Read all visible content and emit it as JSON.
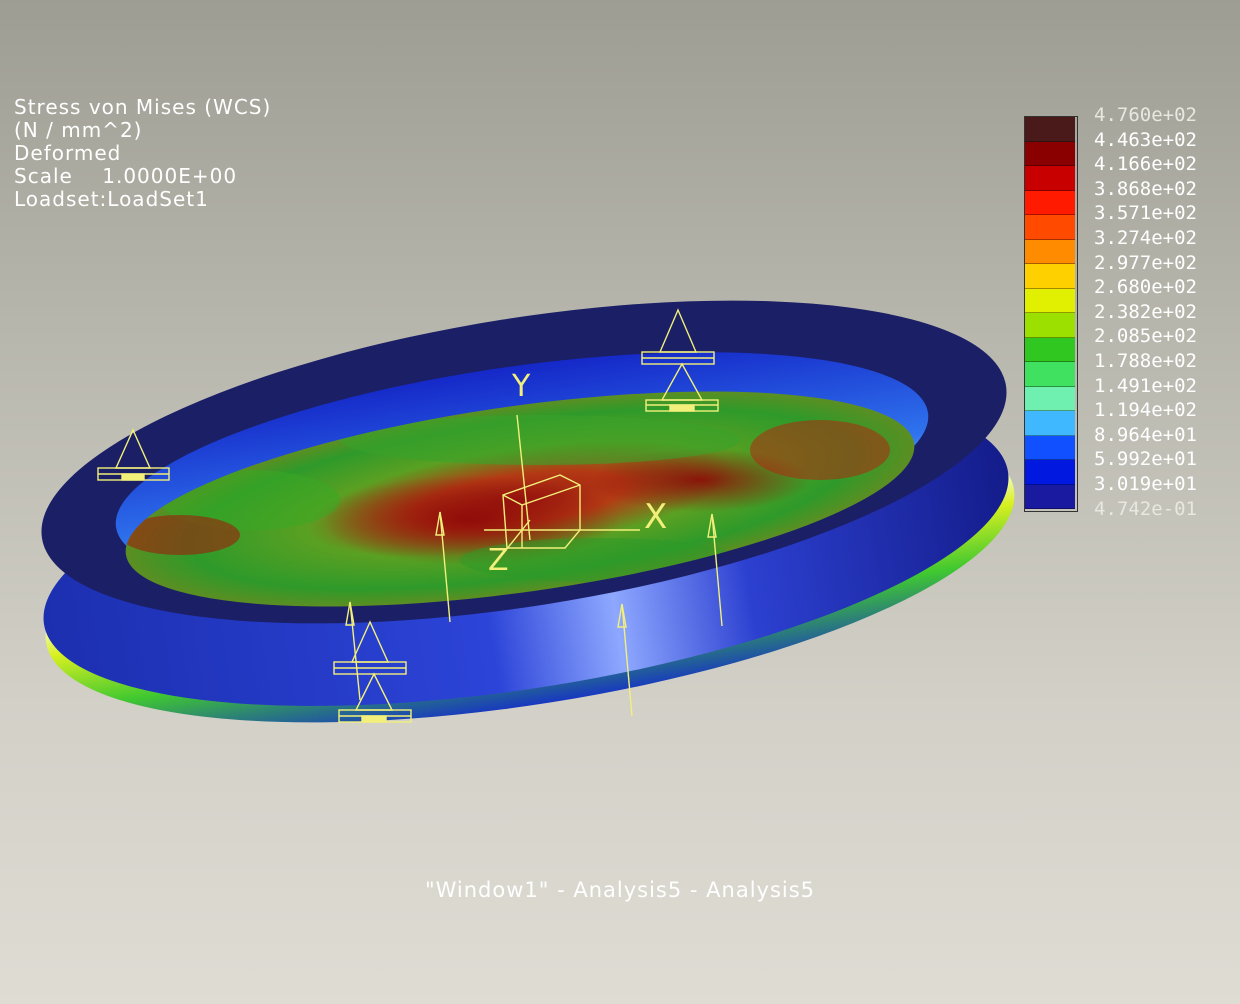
{
  "result_info": {
    "quantity": "Stress von Mises (WCS)",
    "units": "(N / mm^2)",
    "mode": "Deformed",
    "scale_label": "Scale",
    "scale_value": "1.0000E+00",
    "loadset": "Loadset:LoadSet1"
  },
  "legend": {
    "labels": [
      "4.760e+02",
      "4.463e+02",
      "4.166e+02",
      "3.868e+02",
      "3.571e+02",
      "3.274e+02",
      "2.977e+02",
      "2.680e+02",
      "2.382e+02",
      "2.085e+02",
      "1.788e+02",
      "1.491e+02",
      "1.194e+02",
      "8.964e+01",
      "5.992e+01",
      "3.019e+01",
      "4.742e-01"
    ],
    "band_colors": [
      "#4a1a1a",
      "#8a0000",
      "#c80000",
      "#ff1a00",
      "#ff4a00",
      "#ff8c00",
      "#ffd000",
      "#e0f000",
      "#9ce000",
      "#30c820",
      "#40e060",
      "#70f0b0",
      "#40b8ff",
      "#1050ff",
      "#0018e0",
      "#1a1aa0"
    ]
  },
  "axes": {
    "x_label": "X",
    "y_label": "Y",
    "z_label": "Z"
  },
  "window_title": "\"Window1\" - Analysis5 - Analysis5"
}
